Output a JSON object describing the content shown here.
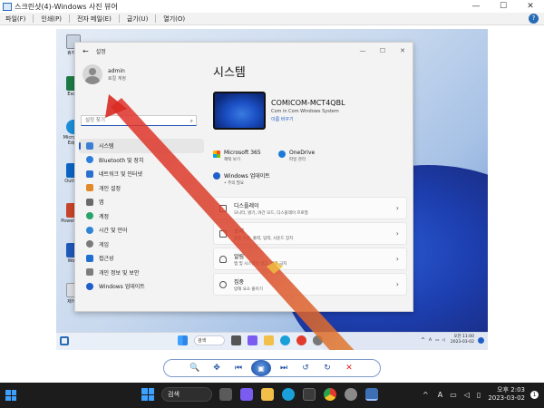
{
  "window": {
    "title": "스크린샷(4)-Windows 사진 뷰어",
    "minimize": "—",
    "maximize": "☐",
    "close": "✕"
  },
  "menu": {
    "items": [
      "파일(F)",
      "인쇄(P)",
      "전자 메일(E)",
      "굽기(U)",
      "열기(O)"
    ],
    "help_icon": "?"
  },
  "desktop_icons": [
    "휴지통",
    "Excel",
    "Microsoft Edge",
    "Outlook",
    "PowerPoint",
    "Word",
    "제어판"
  ],
  "settings": {
    "title": "설정",
    "back": "←",
    "account_name": "admin",
    "account_type": "로컬 계정",
    "search_placeholder": "설정 찾기",
    "nav": [
      "시스템",
      "Bluetooth 및 장치",
      "네트워크 및 인터넷",
      "개인 설정",
      "앱",
      "계정",
      "시간 및 언어",
      "게임",
      "접근성",
      "개인 정보 및 보안",
      "Windows 업데이트"
    ],
    "main_title": "시스템",
    "device_name": "COMICOM-MCT4QBL",
    "device_sub": "Com in Com Windows System",
    "rename_link": "이름 바꾸기",
    "quick": [
      {
        "title": "Microsoft 365",
        "sub": "혜택 보기"
      },
      {
        "title": "OneDrive",
        "sub": "파일 관리"
      }
    ],
    "update": {
      "title": "Windows 업데이트",
      "sub": "• 주의 필요"
    },
    "rows": [
      {
        "title": "디스플레이",
        "sub": "모니터, 밝기, 야간 모드, 디스플레이 프로필"
      },
      {
        "title": "소리",
        "sub": "볼륨 수준, 출력, 입력, 사운드 장치"
      },
      {
        "title": "알림",
        "sub": "앱 및 시스템의 경고, 방해 금지"
      },
      {
        "title": "집중",
        "sub": "방해 요소 줄이기"
      }
    ]
  },
  "inner_taskbar": {
    "search": "검색",
    "clock_time": "오전 11:00",
    "clock_date": "2023-03-02",
    "tray_a": "A"
  },
  "toolbar": {
    "zoom": "🔍",
    "fit": "✥",
    "prev": "⏮",
    "slideshow": "▣",
    "next": "⏭",
    "rotate_left": "↺",
    "rotate_right": "↻",
    "delete": "✕"
  },
  "taskbar": {
    "search": "검색",
    "time": "오후 2:03",
    "date": "2023-03-02",
    "tray_a": "A",
    "notifications": "1"
  }
}
